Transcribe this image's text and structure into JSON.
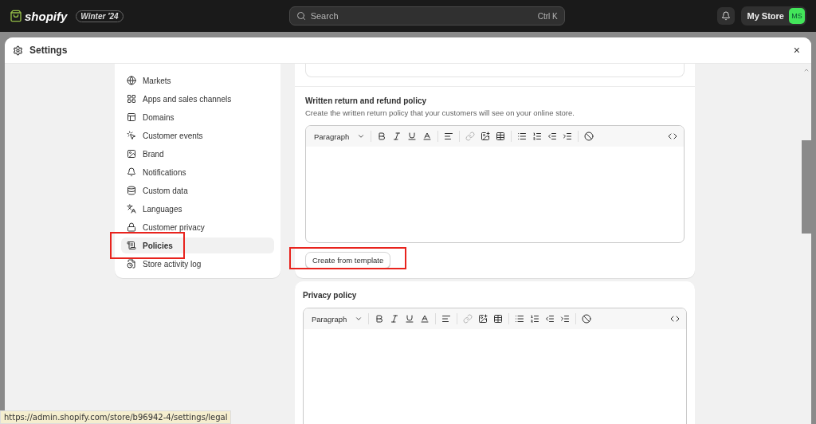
{
  "topbar": {
    "logo": "shopify",
    "edition": "Winter '24",
    "search": {
      "placeholder": "Search",
      "shortcut": "Ctrl K"
    },
    "store": "My Store",
    "avatar": "MS"
  },
  "modal": {
    "title": "Settings",
    "close": "×"
  },
  "sidebar": {
    "items": [
      {
        "label": "Markets",
        "selected": false,
        "highlighted": false
      },
      {
        "label": "Apps and sales channels",
        "selected": false,
        "highlighted": false
      },
      {
        "label": "Domains",
        "selected": false,
        "highlighted": false
      },
      {
        "label": "Customer events",
        "selected": false,
        "highlighted": false
      },
      {
        "label": "Brand",
        "selected": false,
        "highlighted": false
      },
      {
        "label": "Notifications",
        "selected": false,
        "highlighted": false
      },
      {
        "label": "Custom data",
        "selected": false,
        "highlighted": false
      },
      {
        "label": "Languages",
        "selected": false,
        "highlighted": false
      },
      {
        "label": "Customer privacy",
        "selected": false,
        "highlighted": false
      },
      {
        "label": "Policies",
        "selected": true,
        "highlighted": true
      },
      {
        "label": "Store activity log",
        "selected": false,
        "highlighted": false
      }
    ]
  },
  "sections": [
    {
      "title": "Written return and refund policy",
      "description": "Create the written return policy that your customers will see on your online store.",
      "format": "Paragraph",
      "button": {
        "label": "Create from template",
        "highlighted": true
      }
    },
    {
      "title": "Privacy policy",
      "format": "Paragraph"
    }
  ],
  "status_url": "https://admin.shopify.com/store/b96942-4/settings/legal"
}
